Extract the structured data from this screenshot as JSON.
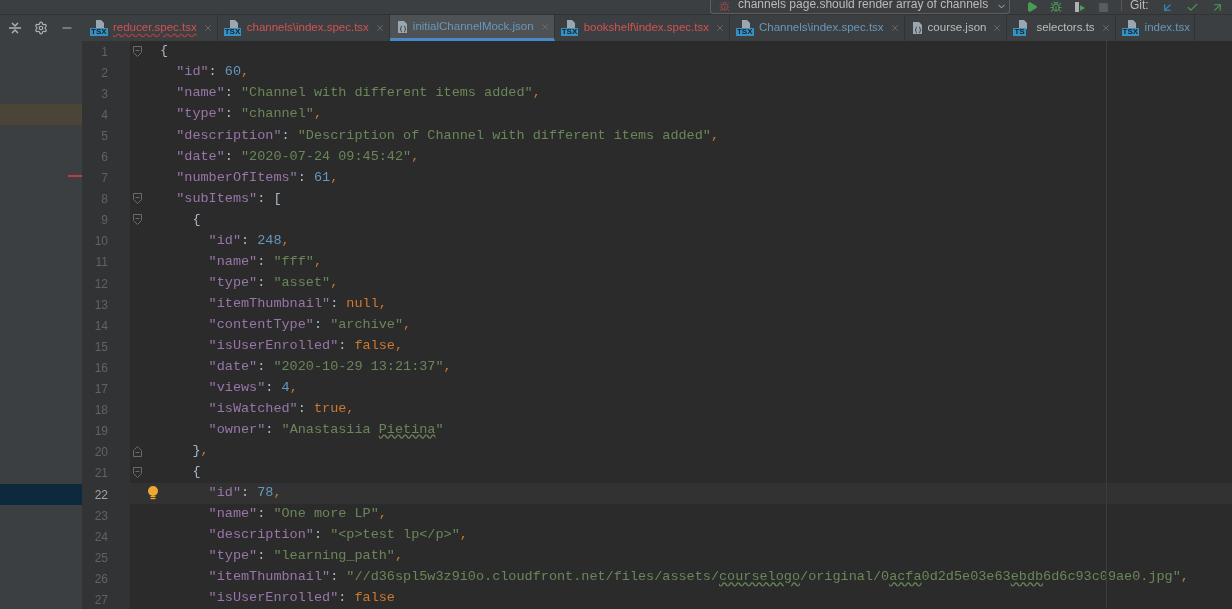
{
  "toolbar": {
    "run_config": "channels page.should render array of channels",
    "vcs_label": "Git:"
  },
  "tabs": [
    {
      "label": "reducer.spec.tsx",
      "icon_label": "TSX",
      "color": "#d25252",
      "error": true,
      "selected": false,
      "closable": true
    },
    {
      "label": "channels\\index.spec.tsx",
      "icon_label": "TSX",
      "color": "#d25252",
      "error": false,
      "selected": false,
      "closable": true
    },
    {
      "label": "initialChannelMock.json",
      "color": "#6897bb",
      "error": false,
      "selected": true,
      "closable": true
    },
    {
      "label": "bookshelf\\index.spec.tsx",
      "icon_label": "TSX",
      "color": "#d25252",
      "error": false,
      "selected": false,
      "closable": true
    },
    {
      "label": "Channels\\index.spec.tsx",
      "icon_label": "TSX",
      "color": "#6897bb",
      "error": false,
      "selected": false,
      "closable": true
    },
    {
      "label": "course.json",
      "color": "#bbbbbb",
      "error": false,
      "selected": false,
      "closable": true
    },
    {
      "label": "selectors.ts",
      "icon_label": "TS",
      "color": "#bbbbbb",
      "error": false,
      "selected": false,
      "closable": true
    },
    {
      "label": "index.tsx",
      "icon_label": "TSX",
      "color": "#6897bb",
      "error": false,
      "selected": false,
      "closable": false
    }
  ],
  "editor": {
    "lines": [
      {
        "number": "1",
        "current": false,
        "fold": {
          "kind": "start"
        },
        "tokens": [
          {
            "kind": "brace",
            "text": "{"
          }
        ]
      },
      {
        "number": "2",
        "current": false,
        "tokens": [
          {
            "kind": "key",
            "text": "  \"id\""
          },
          {
            "kind": "colon",
            "text": ": "
          },
          {
            "kind": "num",
            "text": "60"
          },
          {
            "kind": "punct",
            "text": ","
          }
        ]
      },
      {
        "number": "3",
        "current": false,
        "tokens": [
          {
            "kind": "key",
            "text": "  \"name\""
          },
          {
            "kind": "colon",
            "text": ": "
          },
          {
            "kind": "str",
            "text": "\"Channel with different items added\""
          },
          {
            "kind": "punct",
            "text": ","
          }
        ]
      },
      {
        "number": "4",
        "current": false,
        "side_mark": {
          "kind": "highlight"
        },
        "tokens": [
          {
            "kind": "key",
            "text": "  \"type\""
          },
          {
            "kind": "colon",
            "text": ": "
          },
          {
            "kind": "str",
            "text": "\"channel\""
          },
          {
            "kind": "punct",
            "text": ","
          }
        ]
      },
      {
        "number": "5",
        "current": false,
        "tokens": [
          {
            "kind": "key",
            "text": "  \"description\""
          },
          {
            "kind": "colon",
            "text": ": "
          },
          {
            "kind": "str",
            "text": "\"Description of Channel with different items added\""
          },
          {
            "kind": "punct",
            "text": ","
          }
        ]
      },
      {
        "number": "6",
        "current": false,
        "tokens": [
          {
            "kind": "key",
            "text": "  \"date\""
          },
          {
            "kind": "colon",
            "text": ": "
          },
          {
            "kind": "str",
            "text": "\"2020-07-24 09:45:42\""
          },
          {
            "kind": "punct",
            "text": ","
          }
        ]
      },
      {
        "number": "7",
        "current": false,
        "side_mark": {
          "kind": "error"
        },
        "tokens": [
          {
            "kind": "key",
            "text": "  \"numberOfItems\""
          },
          {
            "kind": "colon",
            "text": ": "
          },
          {
            "kind": "num",
            "text": "61"
          },
          {
            "kind": "punct",
            "text": ","
          }
        ]
      },
      {
        "number": "8",
        "current": false,
        "fold": {
          "kind": "start"
        },
        "tokens": [
          {
            "kind": "key",
            "text": "  \"subItems\""
          },
          {
            "kind": "colon",
            "text": ": "
          },
          {
            "kind": "brace",
            "text": "["
          }
        ]
      },
      {
        "number": "9",
        "current": false,
        "fold": {
          "kind": "start"
        },
        "tokens": [
          {
            "kind": "brace",
            "text": "    {"
          }
        ]
      },
      {
        "number": "10",
        "current": false,
        "tokens": [
          {
            "kind": "key",
            "text": "      \"id\""
          },
          {
            "kind": "colon",
            "text": ": "
          },
          {
            "kind": "num",
            "text": "248"
          },
          {
            "kind": "punct",
            "text": ","
          }
        ]
      },
      {
        "number": "11",
        "current": false,
        "tokens": [
          {
            "kind": "key",
            "text": "      \"name\""
          },
          {
            "kind": "colon",
            "text": ": "
          },
          {
            "kind": "str",
            "text": "\"fff\""
          },
          {
            "kind": "punct",
            "text": ","
          }
        ]
      },
      {
        "number": "12",
        "current": false,
        "tokens": [
          {
            "kind": "key",
            "text": "      \"type\""
          },
          {
            "kind": "colon",
            "text": ": "
          },
          {
            "kind": "str",
            "text": "\"asset\""
          },
          {
            "kind": "punct",
            "text": ","
          }
        ]
      },
      {
        "number": "13",
        "current": false,
        "tokens": [
          {
            "kind": "key",
            "text": "      \"itemThumbnail\""
          },
          {
            "kind": "colon",
            "text": ": "
          },
          {
            "kind": "kw",
            "text": "null"
          },
          {
            "kind": "punct",
            "text": ","
          }
        ]
      },
      {
        "number": "14",
        "current": false,
        "tokens": [
          {
            "kind": "key",
            "text": "      \"contentType\""
          },
          {
            "kind": "colon",
            "text": ": "
          },
          {
            "kind": "str",
            "text": "\"archive\""
          },
          {
            "kind": "punct",
            "text": ","
          }
        ]
      },
      {
        "number": "15",
        "current": false,
        "tokens": [
          {
            "kind": "key",
            "text": "      \"isUserEnrolled\""
          },
          {
            "kind": "colon",
            "text": ": "
          },
          {
            "kind": "kw",
            "text": "false"
          },
          {
            "kind": "punct",
            "text": ","
          }
        ]
      },
      {
        "number": "16",
        "current": false,
        "tokens": [
          {
            "kind": "key",
            "text": "      \"date\""
          },
          {
            "kind": "colon",
            "text": ": "
          },
          {
            "kind": "str",
            "text": "\"2020-10-29 13:21:37\""
          },
          {
            "kind": "punct",
            "text": ","
          }
        ]
      },
      {
        "number": "17",
        "current": false,
        "tokens": [
          {
            "kind": "key",
            "text": "      \"views\""
          },
          {
            "kind": "colon",
            "text": ": "
          },
          {
            "kind": "num",
            "text": "4"
          },
          {
            "kind": "punct",
            "text": ","
          }
        ]
      },
      {
        "number": "18",
        "current": false,
        "tokens": [
          {
            "kind": "key",
            "text": "      \"isWatched\""
          },
          {
            "kind": "colon",
            "text": ": "
          },
          {
            "kind": "kw",
            "text": "true"
          },
          {
            "kind": "punct",
            "text": ","
          }
        ]
      },
      {
        "number": "19",
        "current": false,
        "tokens": [
          {
            "kind": "key",
            "text": "      \"owner\""
          },
          {
            "kind": "colon",
            "text": ": "
          },
          {
            "kind": "str",
            "text": "\"Anastasiia "
          },
          {
            "kind": "typo",
            "text": "Pietina"
          },
          {
            "kind": "str",
            "text": "\""
          }
        ]
      },
      {
        "number": "20",
        "current": false,
        "fold": {
          "kind": "end"
        },
        "tokens": [
          {
            "kind": "brace",
            "text": "    }"
          },
          {
            "kind": "punct",
            "text": ","
          }
        ]
      },
      {
        "number": "21",
        "current": false,
        "fold": {
          "kind": "start"
        },
        "tokens": [
          {
            "kind": "brace",
            "text": "    {"
          }
        ]
      },
      {
        "number": "22",
        "current": true,
        "bulb": true,
        "tokens": [
          {
            "kind": "key",
            "text": "      \"id\""
          },
          {
            "kind": "colon",
            "text": ": "
          },
          {
            "kind": "num",
            "text": "78"
          },
          {
            "kind": "punct",
            "text": ","
          }
        ]
      },
      {
        "number": "23",
        "current": false,
        "tokens": [
          {
            "kind": "key",
            "text": "      \"name\""
          },
          {
            "kind": "colon",
            "text": ": "
          },
          {
            "kind": "str",
            "text": "\"One more LP\""
          },
          {
            "kind": "punct",
            "text": ","
          }
        ]
      },
      {
        "number": "24",
        "current": false,
        "tokens": [
          {
            "kind": "key",
            "text": "      \"description\""
          },
          {
            "kind": "colon",
            "text": ": "
          },
          {
            "kind": "str",
            "text": "\"<p>test lp</p>\""
          },
          {
            "kind": "punct",
            "text": ","
          }
        ]
      },
      {
        "number": "25",
        "current": false,
        "tokens": [
          {
            "kind": "key",
            "text": "      \"type\""
          },
          {
            "kind": "colon",
            "text": ": "
          },
          {
            "kind": "str",
            "text": "\"learning_path\""
          },
          {
            "kind": "punct",
            "text": ","
          }
        ]
      },
      {
        "number": "26",
        "current": false,
        "tokens": [
          {
            "kind": "key",
            "text": "      \"itemThumbnail\""
          },
          {
            "kind": "colon",
            "text": ": "
          },
          {
            "kind": "str",
            "text": "\"//d36spl5w3z9i0o.cloudfront.net/files/assets/"
          },
          {
            "kind": "typo",
            "text": "courselogo"
          },
          {
            "kind": "str",
            "text": "/original/0"
          },
          {
            "kind": "typo",
            "text": "acfa"
          },
          {
            "kind": "str",
            "text": "0d2d5e03e63"
          },
          {
            "kind": "typo",
            "text": "ebdb"
          },
          {
            "kind": "str",
            "text": "6d6c93c09ae0.jpg\""
          },
          {
            "kind": "punct",
            "text": ","
          }
        ]
      },
      {
        "number": "27",
        "current": false,
        "tokens": [
          {
            "kind": "key",
            "text": "      \"isUserEnrolled\""
          },
          {
            "kind": "colon",
            "text": ": "
          },
          {
            "kind": "kw",
            "text": "false"
          }
        ]
      }
    ]
  }
}
